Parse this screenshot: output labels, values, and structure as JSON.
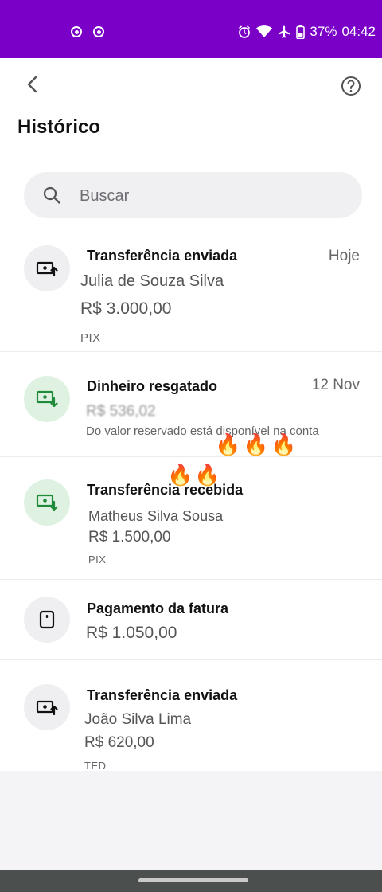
{
  "status_bar": {
    "battery": "37%",
    "time": "04:42"
  },
  "header": {
    "title": "Histórico"
  },
  "search": {
    "placeholder": "Buscar"
  },
  "transactions": [
    {
      "title": "Transferência enviada",
      "date": "Hoje",
      "name": "Julia de Souza Silva",
      "amount": "R$ 3.000,00",
      "method": "PIX",
      "icon": "transfer-sent-icon"
    },
    {
      "title": "Dinheiro resgatado",
      "date": "12 Nov",
      "amount": "R$ 536,02",
      "note": "Do valor reservado está disponível na conta",
      "icon": "money-redeemed-icon"
    },
    {
      "title": "Transferência recebida",
      "name": "Matheus Silva Sousa",
      "amount": "R$ 1.500,00",
      "method": "PIX",
      "icon": "transfer-received-icon"
    },
    {
      "title": "Pagamento da fatura",
      "amount": "R$ 1.050,00",
      "icon": "card-payment-icon"
    },
    {
      "title": "Transferência enviada",
      "name": "João Silva Lima",
      "amount": "R$ 620,00",
      "method": "TED",
      "icon": "transfer-sent-icon"
    }
  ],
  "overlay": {
    "fire_emoji": "🔥"
  },
  "colors": {
    "status_bar": "#7a00c7",
    "icon_green_bg": "#dff2e2",
    "icon_gray_bg": "#efeff2",
    "icon_green_stroke": "#1f8a3a"
  }
}
